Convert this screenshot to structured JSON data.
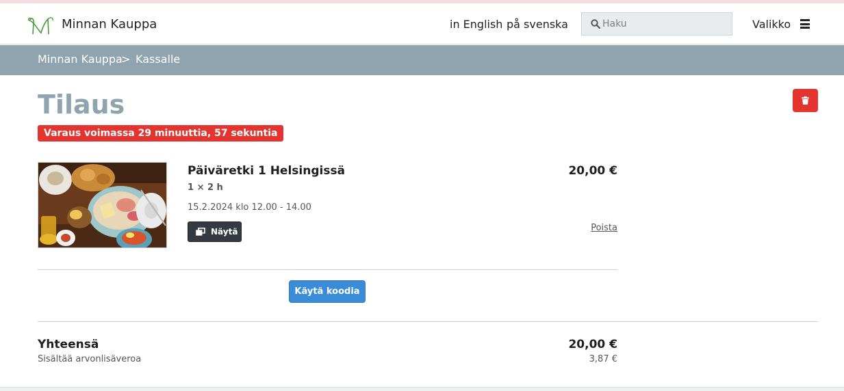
{
  "header": {
    "site_name": "Minnan Kauppa",
    "lang_english": "in English",
    "lang_swedish": "på svenska",
    "search_placeholder": "Haku",
    "menu_label": "Valikko"
  },
  "breadcrumb": {
    "home": "Minnan Kauppa",
    "separator": ">",
    "current": "Kassalle"
  },
  "order": {
    "title": "Tilaus",
    "reservation_notice": "Varaus voimassa 29 minuuttia, 57 sekuntia",
    "item": {
      "name": "Päiväretki 1 Helsingissä",
      "quantity": "1 × 2 h",
      "date": "15.2.2024 klo 12.00 - 14.00",
      "show_label": "Näytä",
      "price": "20,00 €",
      "remove_label": "Poista"
    },
    "use_code_label": "Käytä koodia",
    "total_label": "Yhteensä",
    "total_value": "20,00 €",
    "vat_label": "Sisältää arvonlisäveroa",
    "vat_value": "3,87 €"
  },
  "colors": {
    "accent": "#8fa4ae",
    "danger": "#e3342f",
    "primary": "#3a8bd8",
    "dark": "#343a40",
    "logo_green": "#4a9a3a"
  },
  "icons": {
    "logo": "leaf-m-logo",
    "search": "search-icon",
    "menu": "hamburger-icon",
    "delete": "trash-icon",
    "show": "windows-icon"
  }
}
